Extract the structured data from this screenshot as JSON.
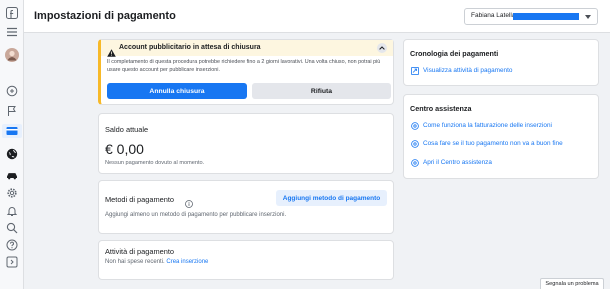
{
  "header": {
    "title": "Impostazioni di pagamento",
    "account_name": "Fabiana Latella"
  },
  "warning": {
    "title": "Account pubblicitario in attesa di chiusura",
    "body": "Il completamento di questa procedura potrebbe richiedere fino a 2 giorni lavorativi. Una volta chiuso, non potrai più usare questo account per pubblicare inserzioni.",
    "cancel_label": "Annulla chiusura",
    "decline_label": "Rifiuta"
  },
  "balance": {
    "label": "Saldo attuale",
    "amount": "€ 0,00",
    "note": "Nessun pagamento dovuto al momento."
  },
  "methods": {
    "label": "Metodi di pagamento",
    "add_label": "Aggiungi metodo di pagamento",
    "note": "Aggiungi almeno un metodo di pagamento per pubblicare inserzioni."
  },
  "activity": {
    "label": "Attività di pagamento",
    "note": "Non hai spese recenti.",
    "link": "Crea inserzione"
  },
  "history": {
    "title": "Cronologia dei pagamenti",
    "link": "Visualizza attività di pagamento"
  },
  "help": {
    "title": "Centro assistenza",
    "links": [
      "Come funziona la fatturazione delle inserzioni",
      "Cosa fare se il tuo pagamento non va a buon fine",
      "Apri il Centro assistenza"
    ]
  },
  "footer": {
    "report_label": "Segnala un problema"
  },
  "colors": {
    "accent": "#1877f2",
    "warning": "#f7b928",
    "background": "#f0f2f5"
  },
  "rail_icons": [
    "facebook-icon",
    "menu-icon",
    "avatar",
    "pages-icon",
    "flag-icon",
    "billing-icon",
    "globe-icon",
    "car-icon",
    "settings-icon",
    "bell-icon",
    "search-icon",
    "help-icon",
    "collapse-icon"
  ]
}
